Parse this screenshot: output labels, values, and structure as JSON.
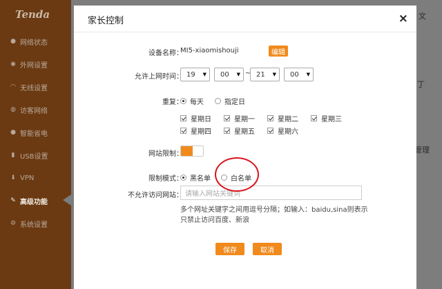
{
  "app": {
    "logo": "Tenda"
  },
  "sidebar": {
    "items": [
      {
        "label": "网络状态",
        "icon": "person-icon"
      },
      {
        "label": "外网设置",
        "icon": "globe-icon"
      },
      {
        "label": "无线设置",
        "icon": "wifi-icon"
      },
      {
        "label": "访客网络",
        "icon": "guest-icon"
      },
      {
        "label": "智能省电",
        "icon": "bulb-icon"
      },
      {
        "label": "USB设置",
        "icon": "usb-icon"
      },
      {
        "label": "VPN",
        "icon": "vpn-icon"
      },
      {
        "label": "高级功能",
        "icon": "wrench-icon",
        "active": true
      },
      {
        "label": "系统设置",
        "icon": "gear-icon"
      }
    ]
  },
  "background": {
    "top_right": "文",
    "text_1": "丁",
    "text_2": "管理"
  },
  "modal": {
    "title": "家长控制",
    "close": "×",
    "device": {
      "label": "设备名称：",
      "value": "MI5-xiaomishouji",
      "edit": "编辑"
    },
    "time": {
      "label": "允许上网时间：",
      "start_hour": "19",
      "start_min": "00",
      "sep": "~",
      "end_hour": "21",
      "end_min": "00"
    },
    "repeat": {
      "label": "重复：",
      "every_day": "每天",
      "specific": "指定日",
      "days": [
        "星期日",
        "星期一",
        "星期二",
        "星期三",
        "星期四",
        "星期五",
        "星期六"
      ]
    },
    "web_limit": {
      "label": "网站限制：",
      "enabled": true
    },
    "mode": {
      "label": "限制模式：",
      "blacklist": "黑名单",
      "whitelist": "白名单",
      "selected": "blacklist"
    },
    "blocked_sites": {
      "label": "不允许访问网站：",
      "placeholder": "请输入网站关键词"
    },
    "hint": "多个网址关键字之间用逗号分隔；如输入：baidu,sina则表示只禁止访问百度、新浪",
    "buttons": {
      "save": "保存",
      "cancel": "取消"
    }
  },
  "colors": {
    "accent": "#f08a1c",
    "sidebar": "#6b3a12",
    "annotation_circle": "#d8141c"
  }
}
